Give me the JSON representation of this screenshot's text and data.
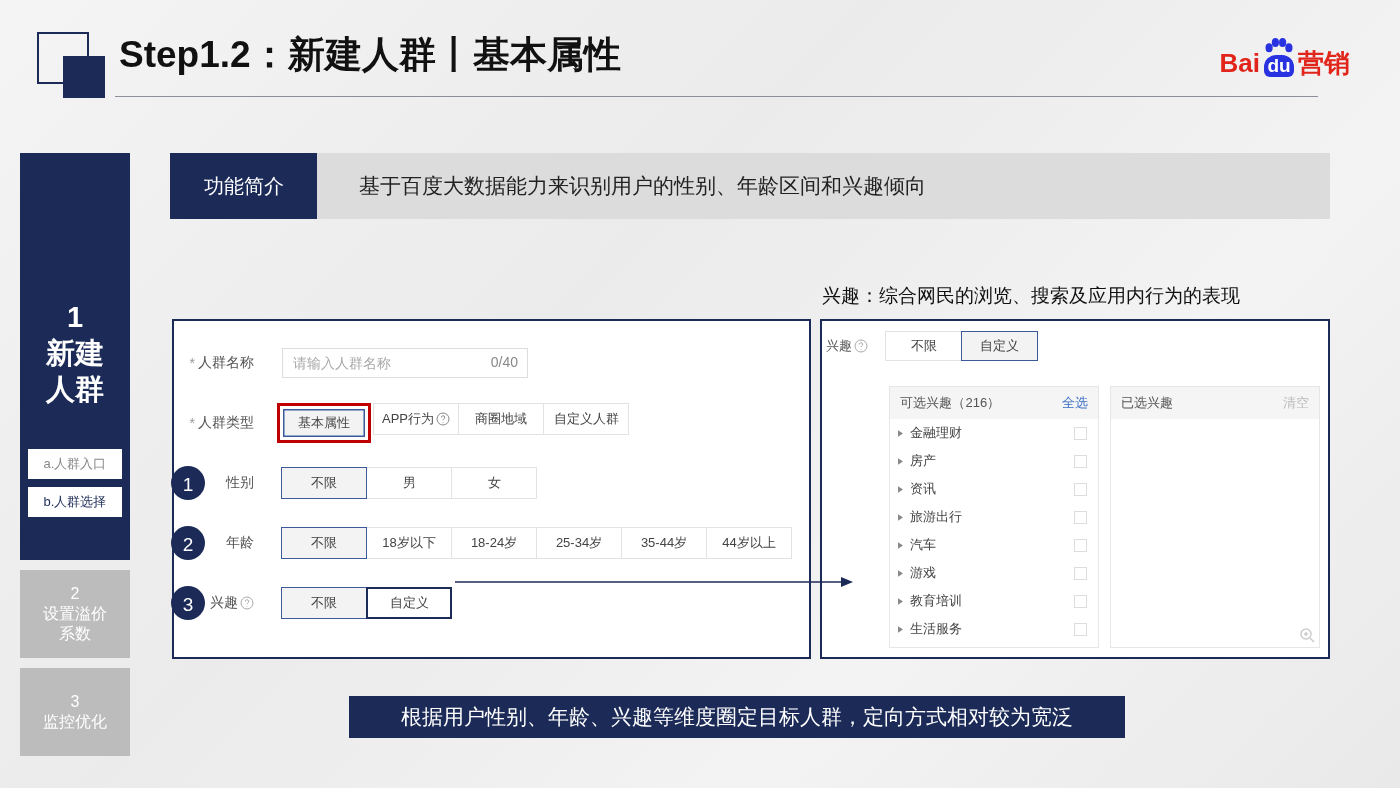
{
  "header": {
    "title": "Step1.2：新建人群丨基本属性",
    "logo": {
      "brand": "Bai",
      "badge": "du",
      "suffix": "营销"
    }
  },
  "steps": [
    {
      "number": "1",
      "label": "新建人群",
      "selected": true,
      "substeps": [
        {
          "label": "a.人群入口",
          "selected": false
        },
        {
          "label": "b.人群选择",
          "selected": true
        }
      ]
    },
    {
      "number": "2",
      "label": "设置溢价系数",
      "selected": false
    },
    {
      "number": "3",
      "label": "监控优化",
      "selected": false
    }
  ],
  "intro": {
    "label": "功能简介",
    "text": "基于百度大数据能力来识别用户的性别、年龄区间和兴趣倾向"
  },
  "form": {
    "rows": [
      {
        "kind": "input",
        "label": "人群名称",
        "required_mark": "*",
        "placeholder": "请输入人群名称",
        "counter": "0/40"
      },
      {
        "kind": "options",
        "label": "人群类型",
        "required_mark": "*",
        "options": [
          {
            "label": "基本属性",
            "selected": true,
            "callout": true,
            "color": "#c00000"
          },
          {
            "label": "APP行为",
            "selected": false,
            "help": true
          },
          {
            "label": "商圈地域",
            "selected": false
          },
          {
            "label": "自定义人群",
            "selected": false
          }
        ]
      },
      {
        "kind": "options",
        "marker": "1",
        "label": "性别",
        "options": [
          {
            "label": "不限",
            "selected": true
          },
          {
            "label": "男",
            "selected": false
          },
          {
            "label": "女",
            "selected": false
          }
        ]
      },
      {
        "kind": "options",
        "marker": "2",
        "label": "年龄",
        "options": [
          {
            "label": "不限",
            "selected": true
          },
          {
            "label": "18岁以下",
            "selected": false
          },
          {
            "label": "18-24岁",
            "selected": false
          },
          {
            "label": "25-34岁",
            "selected": false
          },
          {
            "label": "35-44岁",
            "selected": false
          },
          {
            "label": "44岁以上",
            "selected": false
          }
        ]
      },
      {
        "kind": "options",
        "marker": "3",
        "label": "兴趣",
        "help": true,
        "options": [
          {
            "label": "不限",
            "selected": true
          },
          {
            "label": "自定义",
            "selected": false,
            "callout": true,
            "color": "#1b2a57"
          }
        ]
      }
    ]
  },
  "interest_caption": "兴趣：综合网民的浏览、搜索及应用内行为的表现",
  "interest_panel": {
    "label": "兴趣",
    "options": [
      {
        "label": "不限",
        "selected": false
      },
      {
        "label": "自定义",
        "selected": true
      }
    ],
    "available": {
      "title": "可选兴趣（216）",
      "action": "全选",
      "items": [
        {
          "label": "金融理财",
          "checked": false
        },
        {
          "label": "房产",
          "checked": false
        },
        {
          "label": "资讯",
          "checked": false
        },
        {
          "label": "旅游出行",
          "checked": false
        },
        {
          "label": "汽车",
          "checked": false
        },
        {
          "label": "游戏",
          "checked": false
        },
        {
          "label": "教育培训",
          "checked": false
        },
        {
          "label": "生活服务",
          "checked": false
        }
      ]
    },
    "chosen": {
      "title": "已选兴趣",
      "action": "清空",
      "action_disabled": true
    }
  },
  "summary": "根据用户性别、年龄、兴趣等维度圈定目标人群，定向方式相对较为宽泛"
}
